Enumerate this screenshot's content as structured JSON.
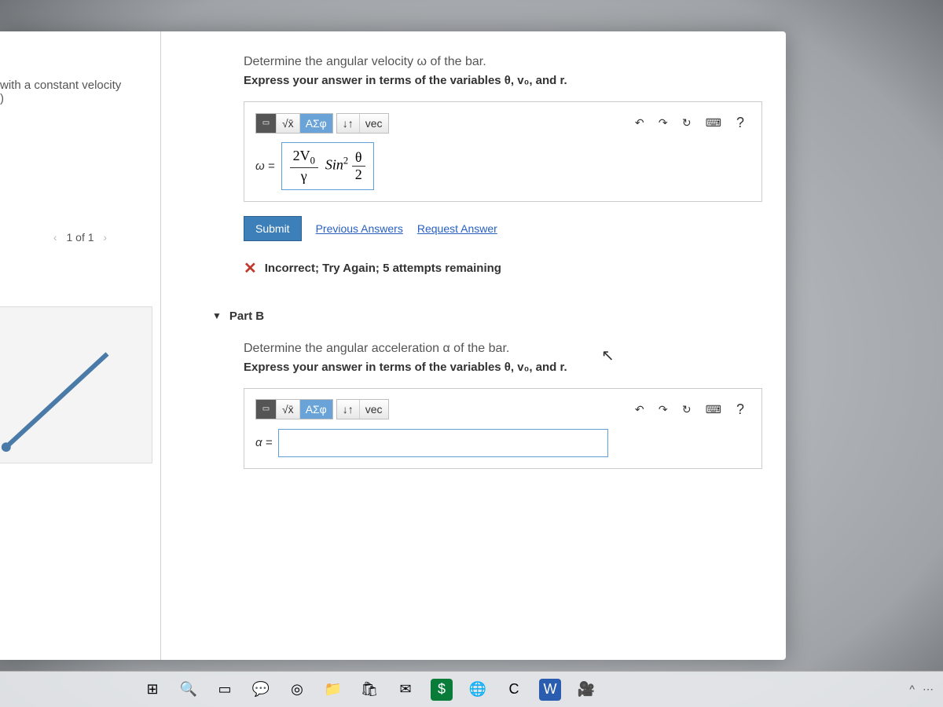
{
  "left": {
    "context_line1": "with a constant velocity",
    "context_line2": ")",
    "figure_nav_prev": "‹",
    "figure_nav_text": "1 of 1",
    "figure_nav_next": "›"
  },
  "partA": {
    "prompt": "Determine the angular velocity ω of the bar.",
    "instruction": "Express your answer in terms of the variables θ, v₀, and r.",
    "toolbar": {
      "templates": "▭",
      "math": "√x̄",
      "greek": "ΑΣφ",
      "updown": "↓↑",
      "vec": "vec",
      "undo": "↶",
      "redo": "↷",
      "reset": "↻",
      "keyboard": "⌨",
      "help": "?"
    },
    "lhs": "ω =",
    "answer_num": "2V",
    "answer_numsub": "0",
    "answer_den": "γ",
    "answer_mid": "Sin",
    "answer_exp": "2",
    "answer_argnum": "θ",
    "answer_argden": "2",
    "submit": "Submit",
    "prev_link": "Previous Answers",
    "req_link": "Request Answer",
    "feedback": "Incorrect; Try Again; 5 attempts remaining"
  },
  "partB": {
    "header": "Part B",
    "prompt": "Determine the angular acceleration α of the bar.",
    "instruction": "Express your answer in terms of the variables θ, v₀, and r.",
    "lhs": "α ="
  },
  "taskbar": {
    "start": "⊞",
    "search": "🔍",
    "tasks": "▭",
    "chat": "💬",
    "chrome": "◎",
    "files": "📁",
    "store": "🛍",
    "mail": "✉",
    "money": "$",
    "edge": "🌐",
    "other": "C",
    "word": "W",
    "video": "🎥"
  },
  "tray": {
    "chevron": "^",
    "extra": "⋯"
  }
}
